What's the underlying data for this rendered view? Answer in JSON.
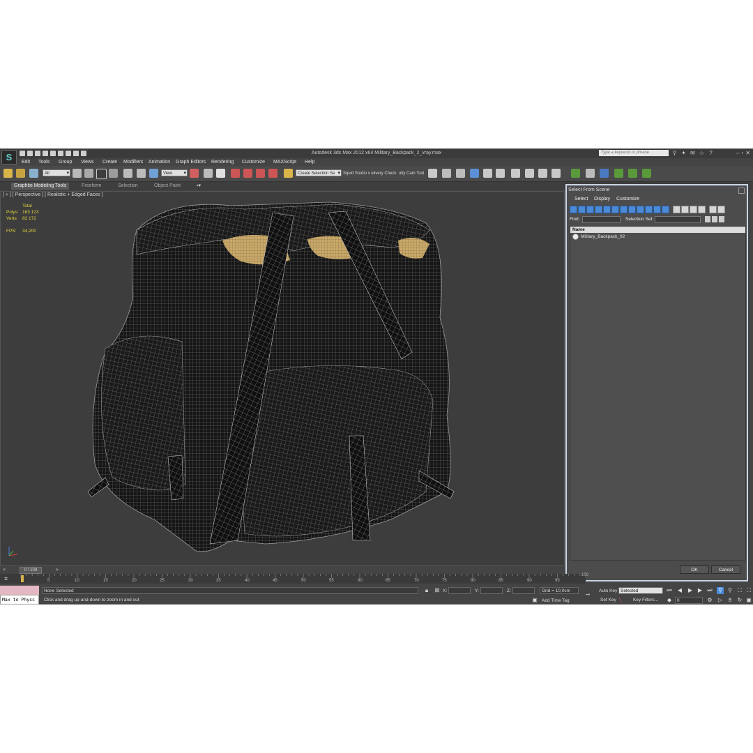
{
  "app": {
    "title": "Autodesk 3ds Max  2012 x64      Military_Backpack_2_vray.max",
    "search_placeholder": "Type a keyword or phrase"
  },
  "menu": [
    "Edit",
    "Tools",
    "Group",
    "Views",
    "Create",
    "Modifiers",
    "Animation",
    "Graph Editors",
    "Rendering",
    "Customize",
    "MAXScript",
    "Help"
  ],
  "toolbar": {
    "selection_filter": "All",
    "reference_coord": "View",
    "named_selection": "Create Selection Se",
    "script_label_1": "Squid Studio v elivery Check",
    "script_label_2": "ulty Cam Tool"
  },
  "ribbon_tabs": [
    "Graphite Modeling Tools",
    "Freeform",
    "Selection",
    "Object Paint"
  ],
  "viewport": {
    "label": "[ + ] [ Perspective ] [ Realistic + Edged Faces ]",
    "stats": {
      "header": "Total",
      "polys_label": "Polys:",
      "polys": "163 123",
      "verts_label": "Verts:",
      "verts": "82 172",
      "fps_label": "FPS:",
      "fps": "34,200"
    }
  },
  "dialog": {
    "title": "Select From Scene",
    "menu": [
      "Select",
      "Display",
      "Customize"
    ],
    "find_label": "Find:",
    "selection_set_label": "Selection Set:",
    "column_name": "Name",
    "items": [
      "Military_Backpack_02"
    ],
    "ok": "OK",
    "cancel": "Cancel"
  },
  "timeline": {
    "slider": "0 / 100",
    "ticks": [
      "5",
      "10",
      "15",
      "20",
      "25",
      "30",
      "35",
      "40",
      "45",
      "50",
      "55",
      "60",
      "65",
      "70",
      "75",
      "80",
      "85",
      "90",
      "95",
      "100"
    ]
  },
  "status": {
    "maxscript": "Max to Physc",
    "selection": "None Selected",
    "prompt": "Click and drag up-and-down to zoom in and out",
    "x_label": "X:",
    "y_label": "Y:",
    "z_label": "Z:",
    "grid": "Grid = 10,0cm",
    "add_time_tag": "Add Time Tag",
    "auto_key": "Auto Key",
    "set_key": "Set Key",
    "key_mode": "Selected",
    "key_filters": "Key Filters...",
    "frame": "0"
  }
}
